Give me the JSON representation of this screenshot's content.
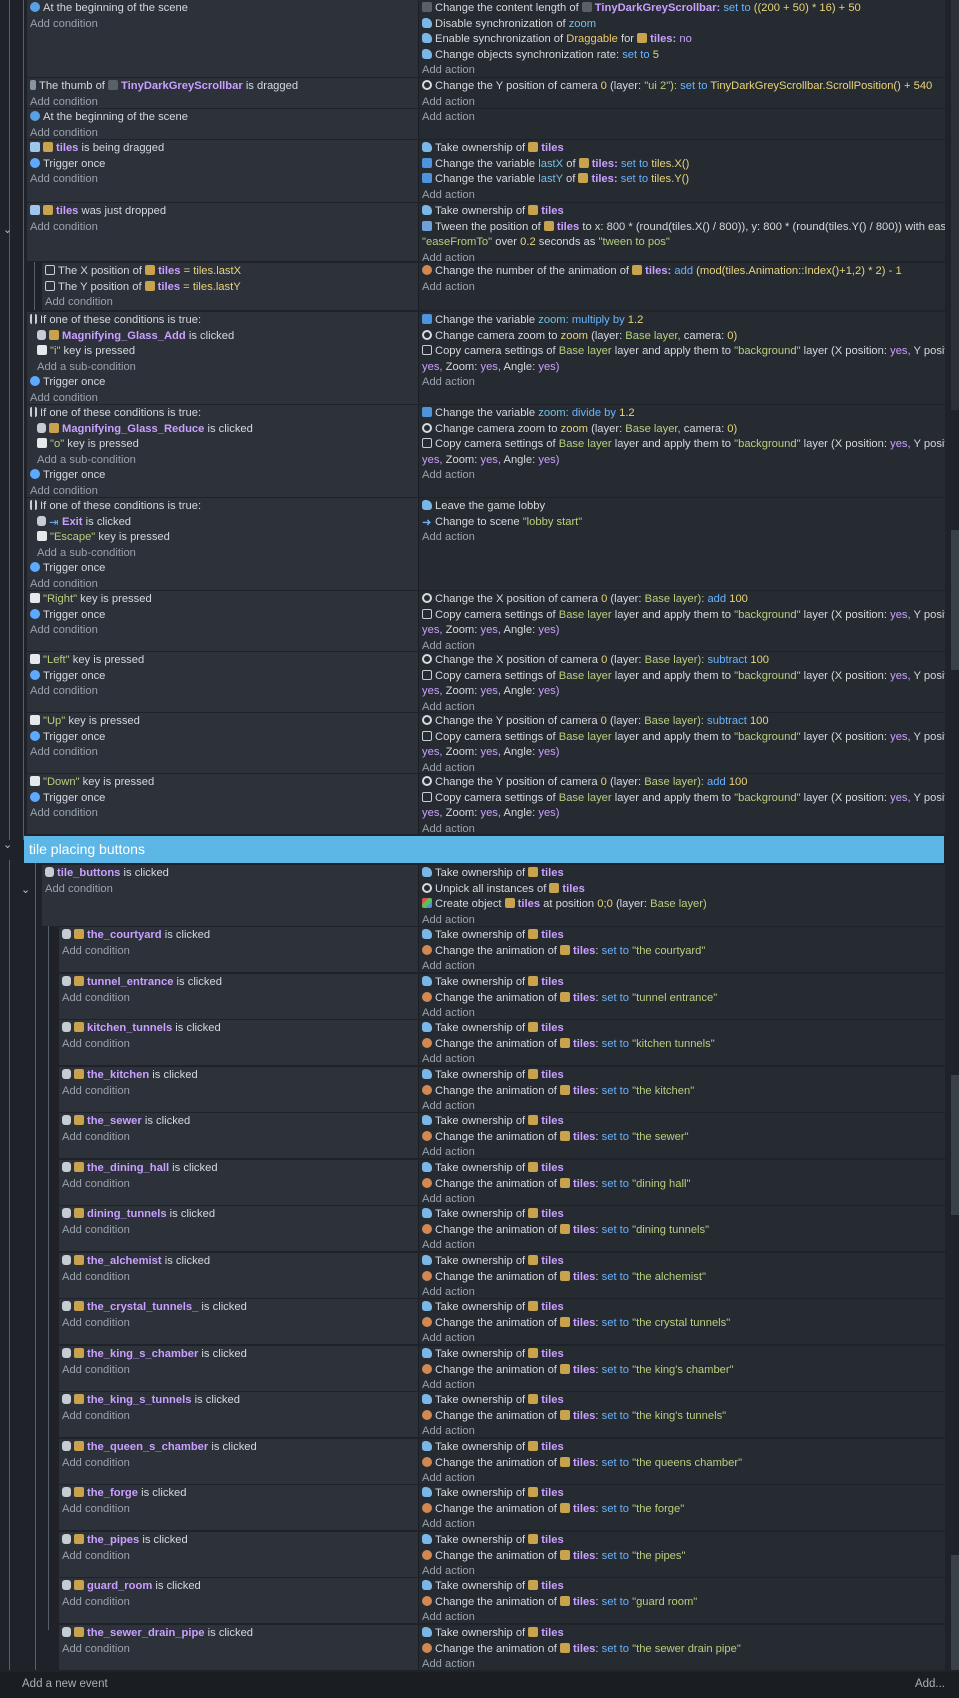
{
  "common": {
    "add_condition": "Add condition",
    "add_action": "Add action",
    "add_subcondition": "Add a sub-condition",
    "trigger_once": "Trigger once",
    "if_one_true": "If one of these conditions is true:",
    "at_beginning": "At the beginning of the scene",
    "is_clicked": "is clicked",
    "is_pressed": "key is pressed",
    "take_ownership": "Take ownership of",
    "change_anim_pre": "Change the animation of",
    "set_to": "set to",
    "tiles": "tiles",
    "collapse_icon": "chevron-down-icon"
  },
  "events": {
    "e1": {
      "a1_pre": "Change the content length of",
      "a1_obj": "TinyDarkGreyScrollbar:",
      "a1_mid": "set to",
      "a1_val": "((200 + 50) * 16) + 50",
      "a2_pre": "Disable synchronization of",
      "a2_var": "zoom",
      "a3_pre": "Enable synchronization of",
      "a3_obj": "Draggable",
      "a3_mid": "for",
      "a3_tiles": "tiles:",
      "a3_val": "no",
      "a4_pre": "Change objects synchronization rate:",
      "a4_mid": "set to",
      "a4_val": "5"
    },
    "e2": {
      "c_pre": "The thumb of",
      "c_obj": "TinyDarkGreyScrollbar",
      "c_post": "is dragged",
      "a_pre": "Change the Y position of camera",
      "a_cam": "0",
      "a_layer": "(layer:",
      "a_layerv": "\"ui 2\"):",
      "a_mid": "set to",
      "a_val": "TinyDarkGreyScrollbar.ScrollPosition() + 540"
    },
    "e4": {
      "c_post": "is being dragged",
      "a2_pre": "Change the variable",
      "a2_var": "lastX",
      "a2_of": "of",
      "a2_tiles": "tiles:",
      "a2_mid": "set to",
      "a2_val": "tiles.X()",
      "a3_pre": "Change the variable",
      "a3_var": "lastY",
      "a3_of": "of",
      "a3_tiles": "tiles:",
      "a3_mid": "set to",
      "a3_val": "tiles.Y()"
    },
    "e5": {
      "c_post": "was just dropped",
      "a2_pre": "Tween the position of",
      "a2_tiles": "tiles",
      "a2_mid": "to x: 800 * (round(tiles.X() / 800)), y: 800 * (round(tiles.Y() / 800)) with easing",
      "a2_ease": "\"easeFromTo\"",
      "a2_over": "over",
      "a2_dur": "0.2",
      "a2_as": "seconds as",
      "a2_id": "\"tween to pos\""
    },
    "e6": {
      "c1_pre": "The X position of",
      "c1_tiles": "tiles",
      "c1_val": "= tiles.lastX",
      "c2_pre": "The Y position of",
      "c2_tiles": "tiles",
      "c2_val": "= tiles.lastY",
      "a_pre": "Change the number of the animation of",
      "a_tiles": "tiles:",
      "a_mid": "add",
      "a_val": "(mod(tiles.Animation::Index()+1,2) * 2) - 1"
    },
    "e7": {
      "c_obj": "Magnifying_Glass_Add",
      "c_key": "\"i\"",
      "a1_pre": "Change the variable",
      "a1_var": "zoom:",
      "a1_mid": "multiply by",
      "a1_val": "1.2",
      "a2_pre": "Change camera zoom to",
      "a2_var": "zoom",
      "a2_post": "(layer:",
      "a2_layer": "Base layer,",
      "a2_post2": "camera:",
      "a2_cam": "0)",
      "a3_pre": "Copy camera settings of",
      "a3_layer": "Base layer",
      "a3_mid": "layer and apply them to",
      "a3_dst": "\"background\"",
      "a3_post": "layer (X position:",
      "a3_yes": "yes,",
      "a3_ypos": "Y position:",
      "a3_l2_yes": "yes,",
      "a3_l2_zoom": "Zoom:",
      "a3_l2_yes2": "yes,",
      "a3_l2_angle": "Angle:",
      "a3_l2_yes3": "yes)"
    },
    "e8": {
      "c_obj": "Magnifying_Glass_Reduce",
      "c_key": "\"o\"",
      "a1_mid": "divide by",
      "a1_val": "1.2"
    },
    "e9": {
      "c_obj": "Exit",
      "c_key": "\"Escape\"",
      "a1": "Leave the game lobby",
      "a2_pre": "Change to scene",
      "a2_val": "\"lobby start\""
    },
    "e10": {
      "keys": [
        "\"Right\"",
        "\"Left\"",
        "\"Up\"",
        "\"Down\""
      ],
      "axis": [
        "X",
        "X",
        "Y",
        "Y"
      ],
      "op": [
        "add",
        "subtract",
        "subtract",
        "add"
      ],
      "val": "100",
      "a1_pre": "Change the",
      "a1_post": "position of camera",
      "a1_cam": "0",
      "a1_layer": "(layer:",
      "a1_layerv": "Base layer):"
    }
  },
  "group": {
    "title": "tile placing buttons"
  },
  "tile_buttons": {
    "c_obj": "tile_buttons",
    "a2_pre": "Unpick all instances of",
    "a3_pre": "Create object",
    "a3_post": "at position",
    "a3_pos": "0;0",
    "a3_layer": "(layer:",
    "a3_layerv": "Base layer)"
  },
  "tile_subevents": [
    {
      "obj": "the_courtyard",
      "anim": "\"the courtyard\""
    },
    {
      "obj": "tunnel_entrance",
      "anim": "\"tunnel entrance\""
    },
    {
      "obj": "kitchen_tunnels",
      "anim": "\"kitchen tunnels\""
    },
    {
      "obj": "the_kitchen",
      "anim": "\"the kitchen\""
    },
    {
      "obj": "the_sewer",
      "anim": "\"the sewer\""
    },
    {
      "obj": "the_dining_hall",
      "anim": "\"dining hall\""
    },
    {
      "obj": "dining_tunnels",
      "anim": "\"dining tunnels\""
    },
    {
      "obj": "the_alchemist",
      "anim": "\"the alchemist\""
    },
    {
      "obj": "the_crystal_tunnels_",
      "anim": "\"the crystal tunnels\""
    },
    {
      "obj": "the_king_s_chamber",
      "anim": "\"the king's chamber\""
    },
    {
      "obj": "the_king_s_tunnels",
      "anim": "\"the king's tunnels\""
    },
    {
      "obj": "the_queen_s_chamber",
      "anim": "\"the queens chamber\""
    },
    {
      "obj": "the_forge",
      "anim": "\"the forge\""
    },
    {
      "obj": "the_pipes",
      "anim": "\"the pipes\""
    },
    {
      "obj": "guard_room",
      "anim": "\"guard room\""
    },
    {
      "obj": "the_sewer_drain_pipe",
      "anim": "\"the sewer drain pipe\""
    }
  ],
  "footer": {
    "add_event": "Add a new event",
    "add_menu": "Add..."
  }
}
